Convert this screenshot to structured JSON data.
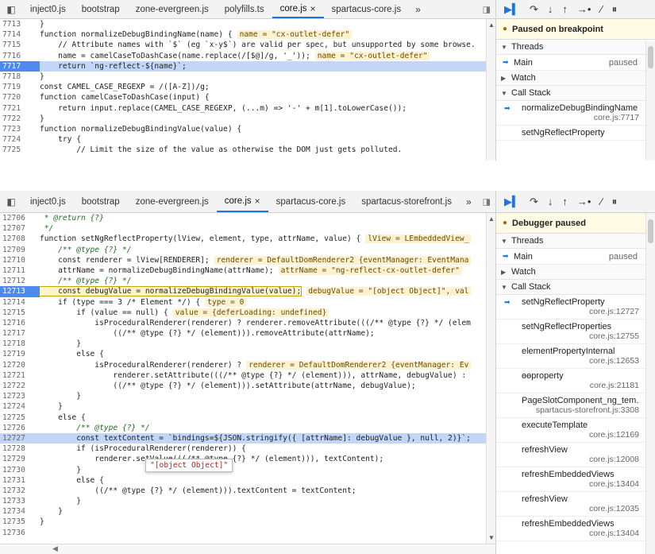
{
  "top": {
    "tabs": [
      {
        "label": "inject0.js"
      },
      {
        "label": "bootstrap"
      },
      {
        "label": "zone-evergreen.js"
      },
      {
        "label": "polyfills.ts"
      },
      {
        "label": "core.js",
        "active": true
      },
      {
        "label": "spartacus-core.js"
      }
    ],
    "overflow": "»",
    "code": [
      {
        "ln": "7713",
        "t": "}"
      },
      {
        "ln": "7714",
        "t": "function normalizeDebugBindingName(name) {",
        "val": "name = \"cx-outlet-defer\""
      },
      {
        "ln": "7715",
        "t": "    // Attribute names with `$` (eg `x-y$`) are valid per spec, but unsupported by some browse."
      },
      {
        "ln": "7716",
        "t": "    name = camelCaseToDashCase(name.replace(/[$@]/g, '_'));",
        "val": "name = \"cx-outlet-defer\""
      },
      {
        "ln": "7717",
        "t": "    return `ng-reflect-${name}`;",
        "exec": true,
        "bp": true
      },
      {
        "ln": "7718",
        "t": "}"
      },
      {
        "ln": "7719",
        "t": "const CAMEL_CASE_REGEXP = /([A-Z])/g;"
      },
      {
        "ln": "7720",
        "t": "function camelCaseToDashCase(input) {"
      },
      {
        "ln": "7721",
        "t": "    return input.replace(CAMEL_CASE_REGEXP, (...m) => '-' + m[1].toLowerCase());"
      },
      {
        "ln": "7722",
        "t": "}"
      },
      {
        "ln": "7723",
        "t": "function normalizeDebugBindingValue(value) {"
      },
      {
        "ln": "7724",
        "t": "    try {"
      },
      {
        "ln": "7725",
        "t": "        // Limit the size of the value as otherwise the DOM just gets polluted."
      }
    ],
    "banner": "Paused on breakpoint",
    "sections": {
      "threads": "Threads",
      "watch": "Watch",
      "callstack": "Call Stack"
    },
    "thread": {
      "name": "Main",
      "state": "paused"
    },
    "frames": [
      {
        "name": "normalizeDebugBindingName",
        "loc": "core.js:7717",
        "current": true
      },
      {
        "name": "setNgReflectProperty",
        "loc": ""
      }
    ]
  },
  "bottom": {
    "tabs": [
      {
        "label": "inject0.js"
      },
      {
        "label": "bootstrap"
      },
      {
        "label": "zone-evergreen.js"
      },
      {
        "label": "core.js",
        "active": true
      },
      {
        "label": "spartacus-core.js"
      },
      {
        "label": "spartacus-storefront.js"
      }
    ],
    "overflow": "»",
    "tooltip": "\"[object Object]\"",
    "code": [
      {
        "ln": "12706",
        "t": " * @return {?}",
        "cm": true
      },
      {
        "ln": "12707",
        "t": " */",
        "cm": true
      },
      {
        "ln": "12708",
        "t": "function setNgReflectProperty(lView, element, type, attrName, value) {",
        "val": "lView = LEmbeddedView_"
      },
      {
        "ln": "12709",
        "t": "    /** @type {?} */",
        "cm": true
      },
      {
        "ln": "12710",
        "t": "    const renderer = lView[RENDERER];",
        "val": "renderer = DefaultDomRenderer2 {eventManager: EventMana"
      },
      {
        "ln": "12711",
        "t": "    attrName = normalizeDebugBindingName(attrName);",
        "val": "attrName = \"ng-reflect-cx-outlet-defer\""
      },
      {
        "ln": "12712",
        "t": "    /** @type {?} */",
        "cm": true
      },
      {
        "ln": "12713",
        "t": "    const debugValue = normalizeDebugBindingValue(value);",
        "val": "debugValue = \"[object Object]\", val",
        "bp": true,
        "boxed": true
      },
      {
        "ln": "12714",
        "t": "    if (type === 3 /* Element */) {",
        "val": "type = 0"
      },
      {
        "ln": "12715",
        "t": "        if (value == null) {",
        "val": "value = {deferLoading: undefined}"
      },
      {
        "ln": "12716",
        "t": "            isProceduralRenderer(renderer) ? renderer.removeAttribute(((/** @type {?} */ (elem"
      },
      {
        "ln": "12717",
        "t": "                ((/** @type {?} */ (element))).removeAttribute(attrName);"
      },
      {
        "ln": "12718",
        "t": "        }"
      },
      {
        "ln": "12719",
        "t": "        else {"
      },
      {
        "ln": "12720",
        "t": "            isProceduralRenderer(renderer) ?",
        "val": "renderer = DefaultDomRenderer2 {eventManager: Ev"
      },
      {
        "ln": "12721",
        "t": "                renderer.setAttribute(((/** @type {?} */ (element))), attrName, debugValue) :"
      },
      {
        "ln": "12722",
        "t": "                ((/** @type {?} */ (element))).setAttribute(attrName, debugValue);"
      },
      {
        "ln": "12723",
        "t": "        }"
      },
      {
        "ln": "12724",
        "t": "    }"
      },
      {
        "ln": "12725",
        "t": "    else {"
      },
      {
        "ln": "12726",
        "t": "        /** @type {?} */",
        "cm": true
      },
      {
        "ln": "12727",
        "t": "        const textContent = `bindings=${JSON.stringify({ [attrName]: debugValue }, null, 2)}`;",
        "exec": true
      },
      {
        "ln": "12728",
        "t": "        if (isProceduralRenderer(renderer)) {"
      },
      {
        "ln": "12729",
        "t": "            renderer.setValue(((/** @type {?} */ (element))), textContent);"
      },
      {
        "ln": "12730",
        "t": "        }"
      },
      {
        "ln": "12731",
        "t": "        else {"
      },
      {
        "ln": "12732",
        "t": "            ((/** @type {?} */ (element))).textContent = textContent;"
      },
      {
        "ln": "12733",
        "t": "        }"
      },
      {
        "ln": "12734",
        "t": "    }"
      },
      {
        "ln": "12735",
        "t": "}"
      },
      {
        "ln": "12736",
        "t": ""
      }
    ],
    "banner": "Debugger paused",
    "sections": {
      "threads": "Threads",
      "watch": "Watch",
      "callstack": "Call Stack"
    },
    "thread": {
      "name": "Main",
      "state": "paused"
    },
    "frames": [
      {
        "name": "setNgReflectProperty",
        "loc": "core.js:12727",
        "current": true
      },
      {
        "name": "setNgReflectProperties",
        "loc": "core.js:12755"
      },
      {
        "name": "elementPropertyInternal",
        "loc": "core.js:12653"
      },
      {
        "name": "ɵɵproperty",
        "loc": "core.js:21181"
      },
      {
        "name": "PageSlotComponent_ng_tem...",
        "loc": "spartacus-storefront.js:3308"
      },
      {
        "name": "executeTemplate",
        "loc": "core.js:12169"
      },
      {
        "name": "refreshView",
        "loc": "core.js:12008"
      },
      {
        "name": "refreshEmbeddedViews",
        "loc": "core.js:13404"
      },
      {
        "name": "refreshView",
        "loc": "core.js:12035"
      },
      {
        "name": "refreshEmbeddedViews",
        "loc": "core.js:13404"
      }
    ]
  },
  "icons": {
    "resume": "resume-icon",
    "step-over": "step-over-icon",
    "step-into": "step-into-icon",
    "step-out": "step-out-icon",
    "step": "step-icon",
    "deactivate": "deactivate-breakpoints-icon",
    "pause-exceptions": "pause-on-exceptions-icon"
  },
  "colors": {
    "accent": "#1a73e8",
    "exec_line": "#c2d7f7",
    "breakpoint": "#4d8af0",
    "inline_value_bg": "#fdf3d2"
  }
}
